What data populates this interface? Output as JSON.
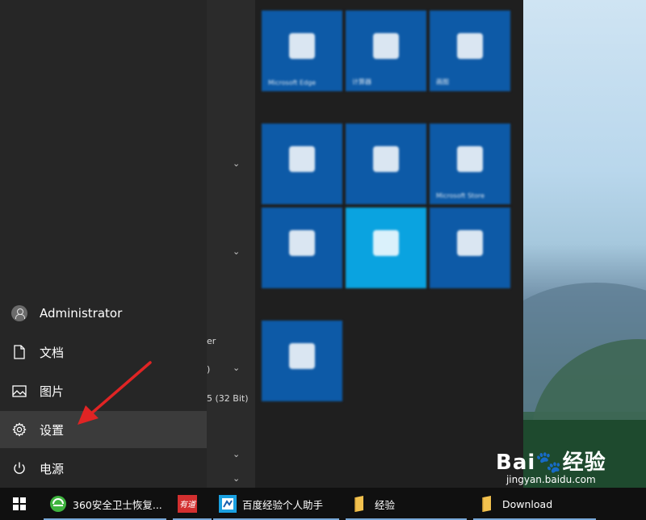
{
  "start_menu": {
    "left_rail": {
      "user": {
        "label": "Administrator"
      },
      "items": [
        {
          "label": "文档",
          "icon": "document-icon"
        },
        {
          "label": "图片",
          "icon": "picture-icon"
        },
        {
          "label": "设置",
          "icon": "gear-icon",
          "active": true
        },
        {
          "label": "电源",
          "icon": "power-icon"
        }
      ]
    },
    "apps_partial": [
      "er",
      ")",
      "5 (32 Bit)"
    ],
    "tiles": [
      {
        "label": "Microsoft Edge"
      },
      {
        "label": "计算器"
      },
      {
        "label": "画图"
      },
      {
        "label": ""
      },
      {
        "label": ""
      },
      {
        "label": "Microsoft Store"
      },
      {
        "label": ""
      },
      {
        "label": ""
      },
      {
        "label": ""
      },
      {
        "label": ""
      }
    ]
  },
  "taskbar": {
    "items": [
      {
        "label": "360安全卫士恢复...",
        "icon": "360-security-icon"
      },
      {
        "label": "",
        "icon": "youdao-icon"
      },
      {
        "label": "百度经验个人助手",
        "icon": "baidu-helper-icon"
      },
      {
        "label": "经验",
        "icon": "folder-icon"
      },
      {
        "label": "Download",
        "icon": "folder-icon"
      }
    ]
  },
  "watermark": {
    "main": "Bai🐾经验",
    "sub": "jingyan.baidu.com"
  },
  "colors": {
    "tile_blue": "#0d5aa7",
    "tile_light_blue": "#0aa3e0",
    "active_item": "#3b3b3b",
    "annotation_red": "#e02424"
  }
}
